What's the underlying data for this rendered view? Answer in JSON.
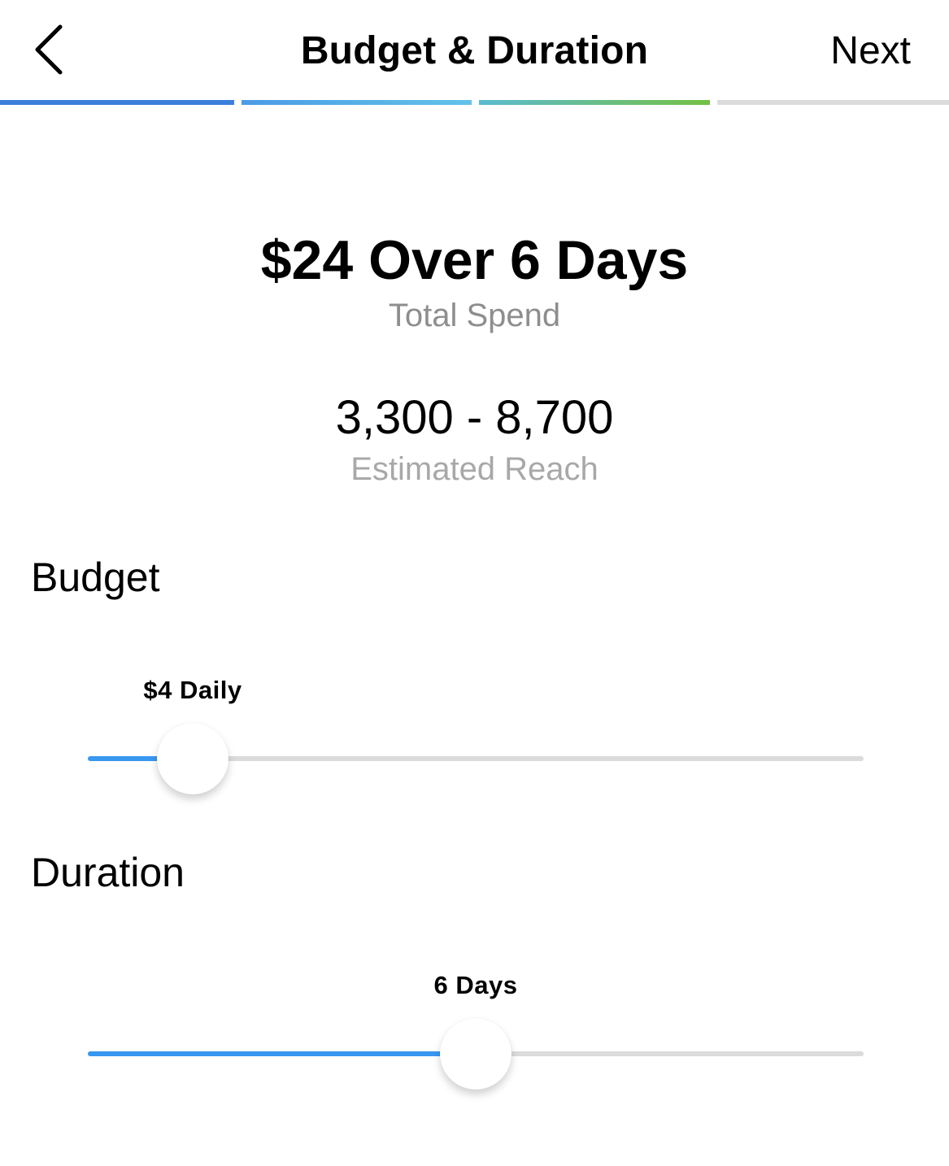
{
  "header": {
    "title": "Budget & Duration",
    "back_icon": "chevron-left-icon",
    "next_label": "Next"
  },
  "progress": {
    "steps": [
      {
        "state": "complete",
        "color": "#3b7fdc"
      },
      {
        "state": "complete",
        "color_from": "#4a9be6",
        "color_to": "#63c2e8"
      },
      {
        "state": "current",
        "color_from": "#5bbbd0",
        "color_to": "#74c044"
      },
      {
        "state": "upcoming",
        "color": "#dbdbdb"
      }
    ]
  },
  "summary": {
    "total": "$24 Over 6 Days",
    "total_label": "Total Spend",
    "reach": "3,300 - 8,700",
    "reach_label": "Estimated Reach"
  },
  "budget": {
    "title": "Budget",
    "value_label": "$4 Daily",
    "fraction": 0.135
  },
  "duration": {
    "title": "Duration",
    "value_label": "6 Days",
    "fraction": 0.5
  },
  "colors": {
    "accent": "#3897f0",
    "track": "#dbdbdb",
    "secondary_text": "#8e8e8e"
  }
}
